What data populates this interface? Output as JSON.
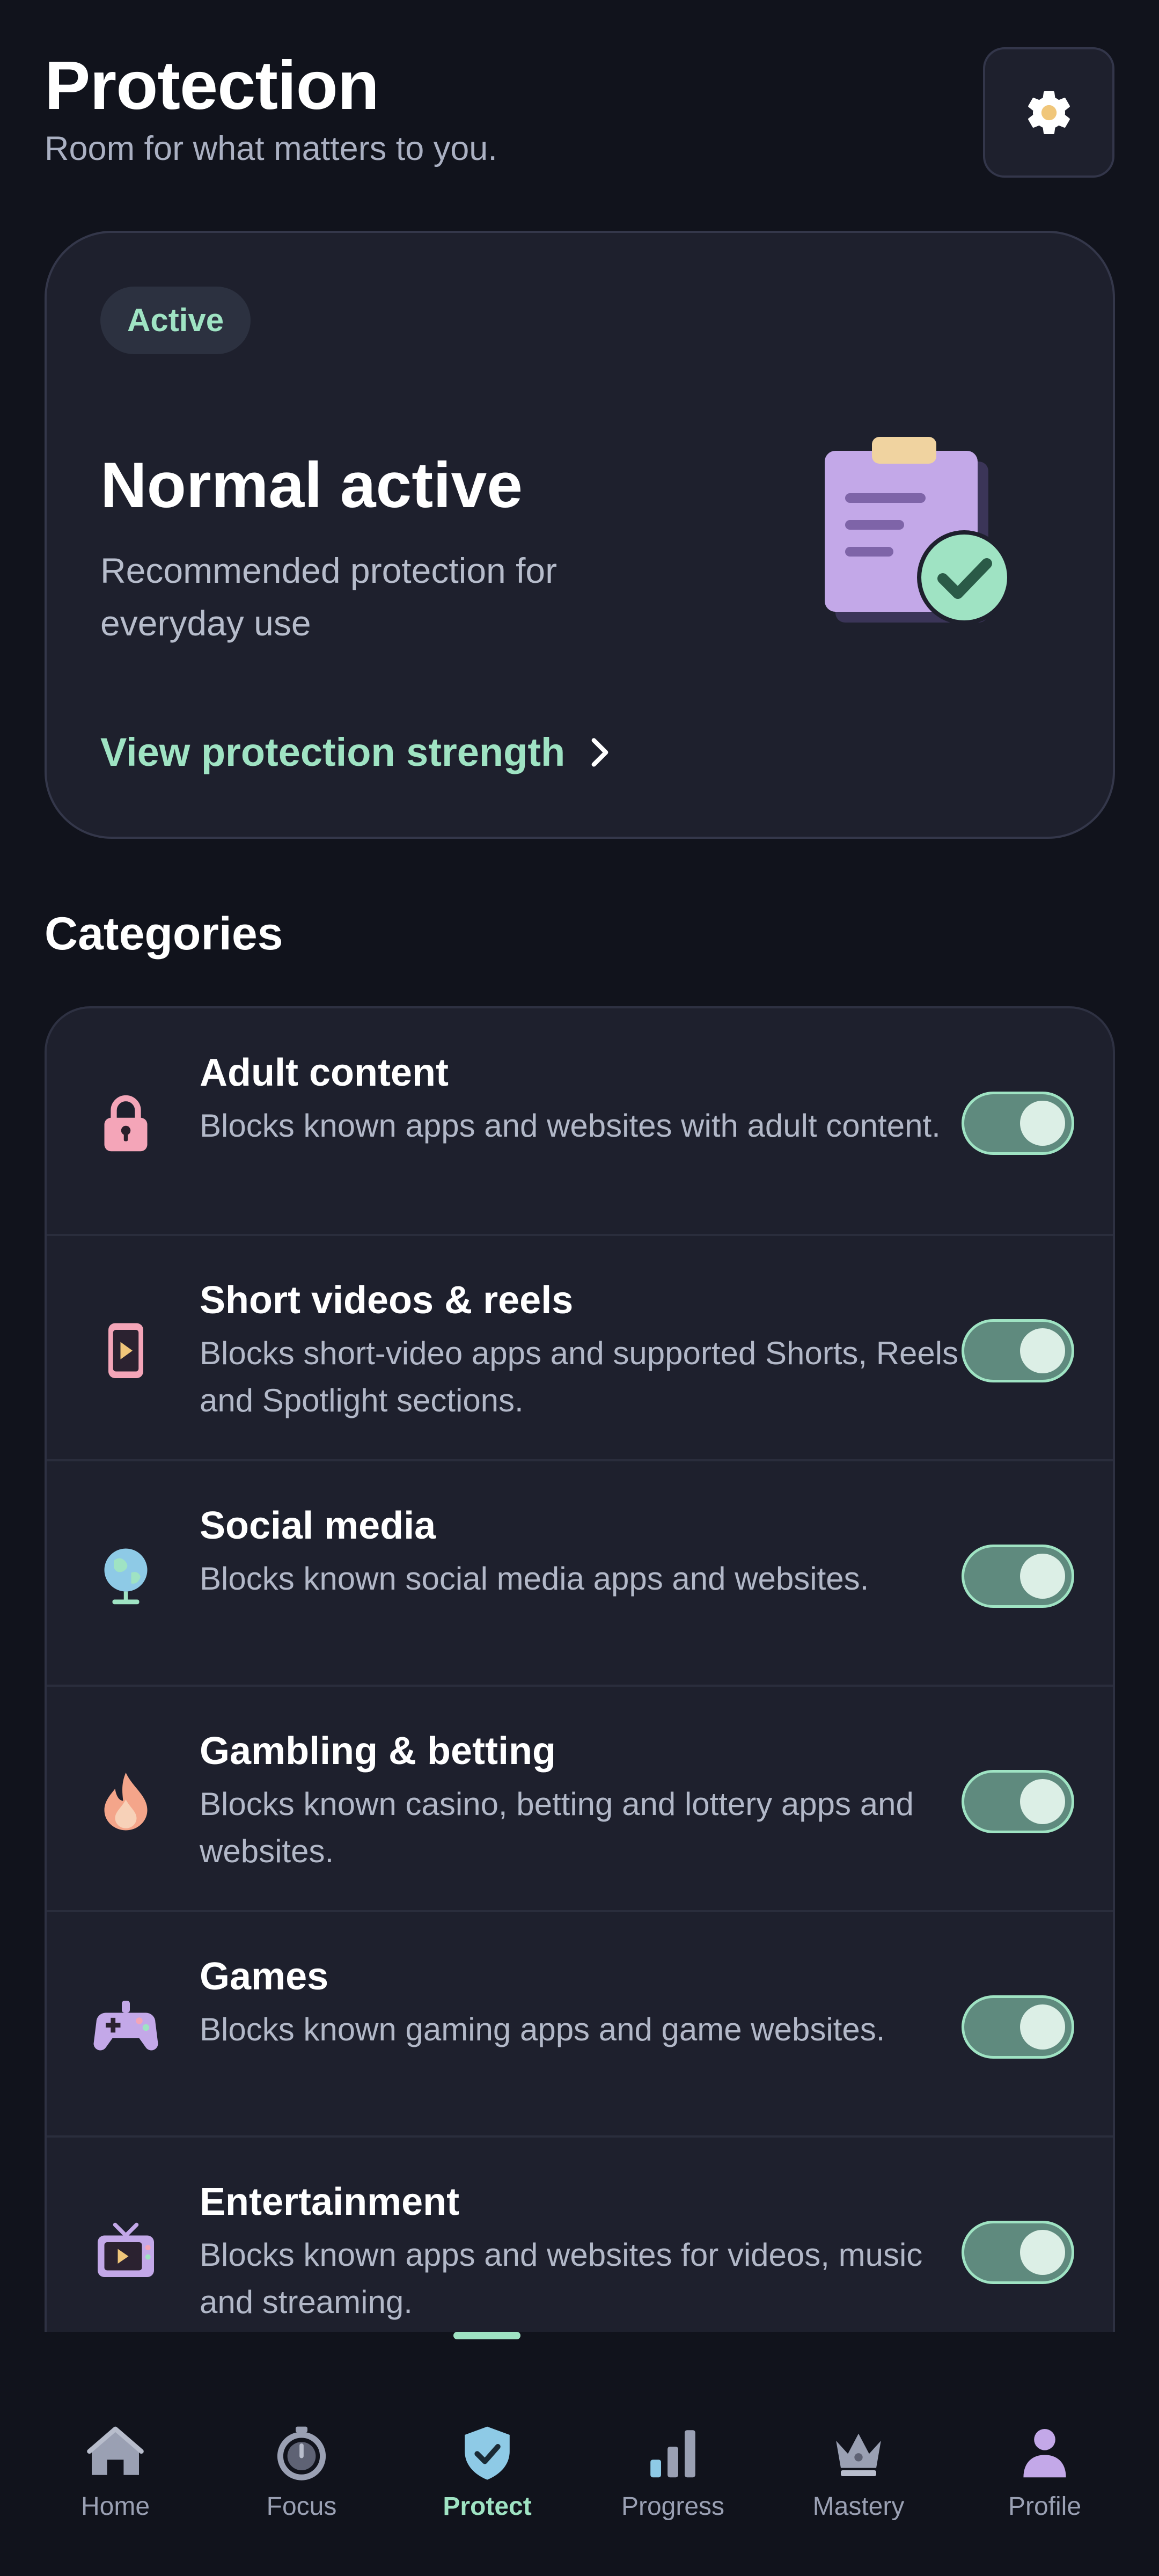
{
  "header": {
    "title": "Protection",
    "subtitle": "Room for what matters to you.",
    "settings_icon": "gear-icon"
  },
  "status_card": {
    "badge": "Active",
    "mode_title": "Normal active",
    "description": "Recommended protection for everyday use",
    "link_label": "View protection strength",
    "illustration": "clipboard-check-illustration"
  },
  "categories": {
    "section_title": "Categories",
    "items": [
      {
        "title": "Adult content",
        "description": "Blocks known apps and websites with adult content.",
        "icon": "lock-icon",
        "enabled": true
      },
      {
        "title": "Short videos & reels",
        "description": "Blocks short-video apps and supported Shorts, Reels and Spotlight sections.",
        "icon": "phone-play-icon",
        "enabled": true
      },
      {
        "title": "Social media",
        "description": "Blocks known social media apps and websites.",
        "icon": "globe-icon",
        "enabled": true
      },
      {
        "title": "Gambling & betting",
        "description": "Blocks known casino, betting and lottery apps and websites.",
        "icon": "flame-icon",
        "enabled": true
      },
      {
        "title": "Games",
        "description": "Blocks known gaming apps and game websites.",
        "icon": "gamepad-icon",
        "enabled": true
      },
      {
        "title": "Entertainment",
        "description": "Blocks known apps and websites for videos, music and streaming.",
        "icon": "tv-icon",
        "enabled": true
      }
    ]
  },
  "nav": {
    "items": [
      {
        "label": "Home",
        "icon": "home-icon"
      },
      {
        "label": "Focus",
        "icon": "stopwatch-icon"
      },
      {
        "label": "Protect",
        "icon": "shield-check-icon",
        "active": true
      },
      {
        "label": "Progress",
        "icon": "bar-chart-icon"
      },
      {
        "label": "Mastery",
        "icon": "crown-icon"
      },
      {
        "label": "Profile",
        "icon": "person-icon"
      }
    ]
  },
  "colors": {
    "background": "#11131c",
    "card": "#1e202d",
    "accent": "#9fe3c3",
    "toggle_track": "#5f8a7e"
  }
}
